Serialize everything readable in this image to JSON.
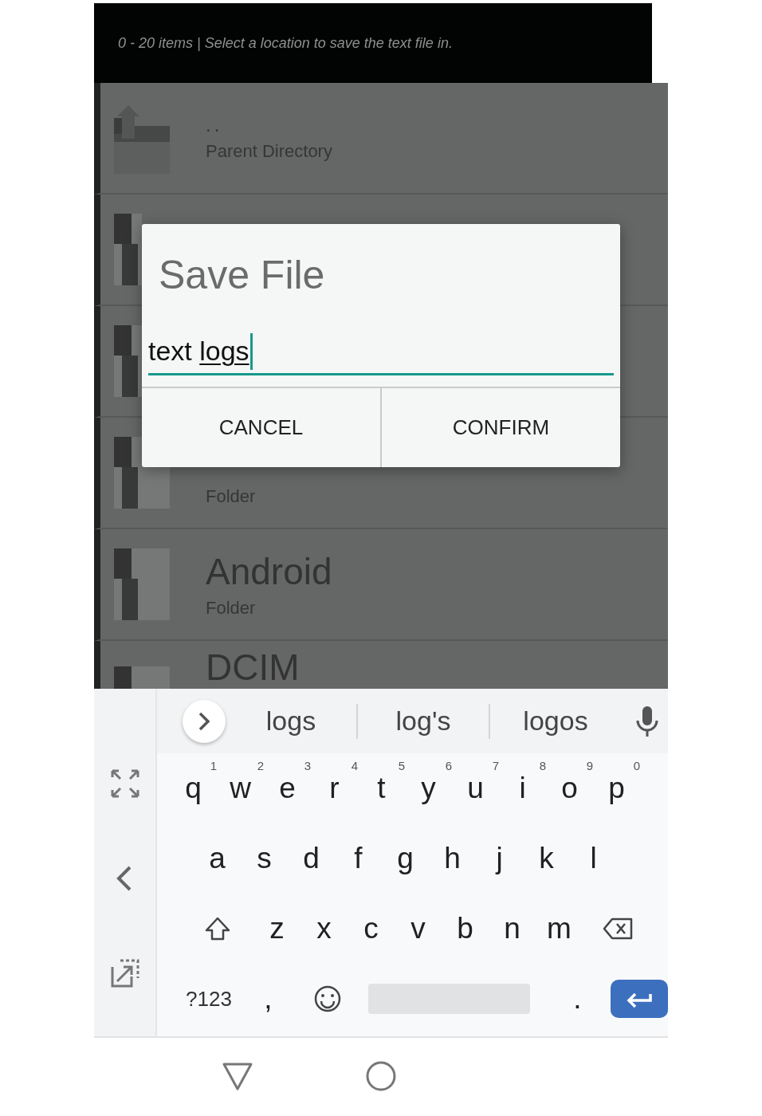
{
  "header": {
    "text": "0 - 20 items | Select a location to save the text file in."
  },
  "list": {
    "rows": [
      {
        "kind": "parent",
        "name": "..",
        "subtitle": "Parent Directory"
      },
      {
        "kind": "folder"
      },
      {
        "kind": "folder"
      },
      {
        "kind": "folder",
        "subtitle": "Folder"
      },
      {
        "kind": "folder",
        "name": "Android",
        "subtitle": "Folder"
      },
      {
        "kind": "folder",
        "name": "DCIM"
      }
    ]
  },
  "dialog": {
    "title": "Save File",
    "input": {
      "value": "text ",
      "composing": "logs"
    },
    "buttons": [
      "CANCEL",
      "CONFIRM"
    ]
  },
  "keyboard": {
    "suggestions": [
      "logs",
      "log's",
      "logos"
    ],
    "rows": [
      [
        {
          "label": "q",
          "hint": "1"
        },
        {
          "label": "w",
          "hint": "2"
        },
        {
          "label": "e",
          "hint": "3"
        },
        {
          "label": "r",
          "hint": "4"
        },
        {
          "label": "t",
          "hint": "5"
        },
        {
          "label": "y",
          "hint": "6"
        },
        {
          "label": "u",
          "hint": "7"
        },
        {
          "label": "i",
          "hint": "8"
        },
        {
          "label": "o",
          "hint": "9"
        },
        {
          "label": "p",
          "hint": "0"
        }
      ],
      [
        {
          "label": "a"
        },
        {
          "label": "s"
        },
        {
          "label": "d"
        },
        {
          "label": "f"
        },
        {
          "label": "g"
        },
        {
          "label": "h"
        },
        {
          "label": "j"
        },
        {
          "label": "k"
        },
        {
          "label": "l"
        }
      ],
      [
        {
          "kind": "shift"
        },
        {
          "label": "z"
        },
        {
          "label": "x"
        },
        {
          "label": "c"
        },
        {
          "label": "v"
        },
        {
          "label": "b"
        },
        {
          "label": "n"
        },
        {
          "label": "m"
        },
        {
          "kind": "backspace"
        }
      ],
      [
        {
          "kind": "symbols",
          "label": "?123"
        },
        {
          "label": ","
        },
        {
          "kind": "emoji"
        },
        {
          "kind": "space"
        },
        {
          "label": "."
        },
        {
          "kind": "enter"
        }
      ]
    ]
  }
}
